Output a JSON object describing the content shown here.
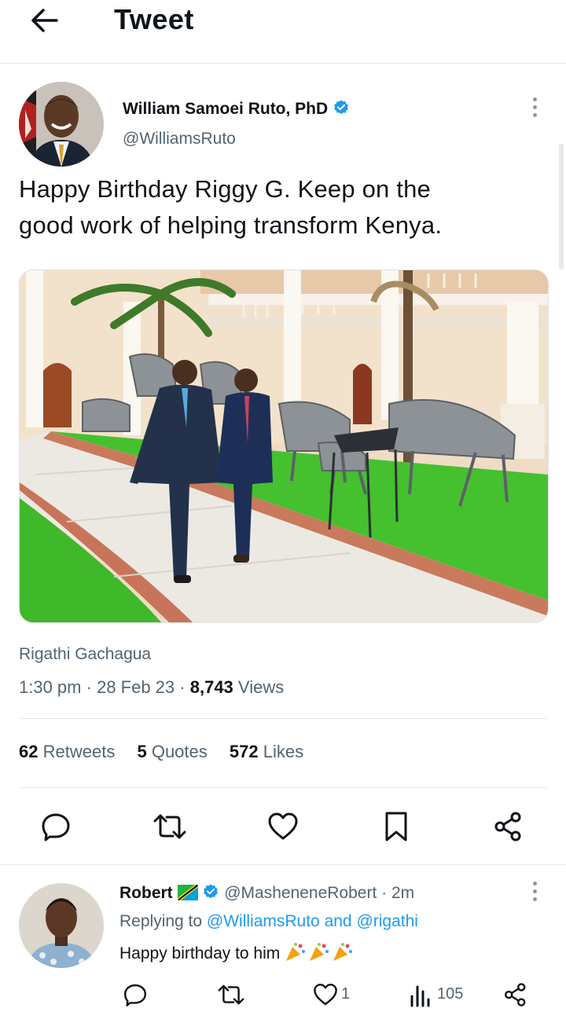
{
  "header": {
    "title": "Tweet"
  },
  "tweet": {
    "author_name": "William Samoei Ruto, PhD",
    "author_handle": "@WilliamsRuto",
    "text_line1": "Happy Birthday Riggy G. Keep on the",
    "text_line2": "good work of helping transform Kenya.",
    "source": "Rigathi Gachagua",
    "time": "1:30 pm",
    "date": "28 Feb 23",
    "views_count": "8,743",
    "views_label": "Views",
    "retweets_count": "62",
    "retweets_label": "Retweets",
    "quotes_count": "5",
    "quotes_label": "Quotes",
    "likes_count": "572",
    "likes_label": "Likes"
  },
  "reply": {
    "author_name": "Robert",
    "author_handle": "@MasheneneRobert",
    "time": "2m",
    "replying_prefix": "Replying to",
    "replying_to": "@WilliamsRuto and @rigathi",
    "text": "Happy birthday to him",
    "likes": "1",
    "views": "105"
  },
  "colors": {
    "accent": "#1d9bf0",
    "text": "#0f1419",
    "muted": "#536471"
  }
}
